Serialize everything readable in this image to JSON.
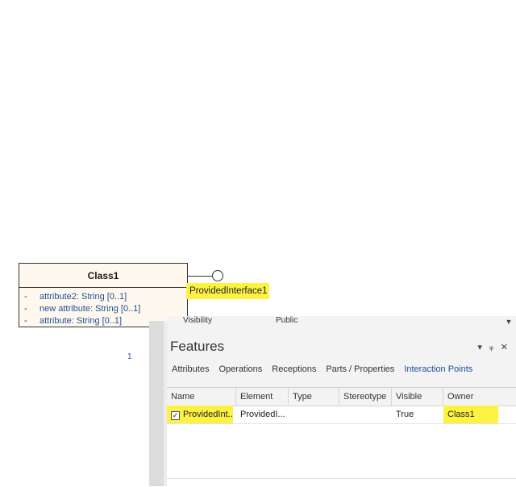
{
  "diagram": {
    "class_name": "Class1",
    "attributes": [
      {
        "visibility": "-",
        "text": "attribute2: String [0..1]"
      },
      {
        "visibility": "-",
        "text": "new attribute: String [0..1]"
      },
      {
        "visibility": "-",
        "text": "attribute: String [0..1]"
      }
    ],
    "port_label": "ProvidedInterface1",
    "stray_mark": "1"
  },
  "property_row": {
    "name": "Visibility",
    "value": "Public",
    "scroll_icon": "▼"
  },
  "features": {
    "title": "Features",
    "controls": {
      "dropdown": "▾",
      "pin": "ᵩ",
      "close": "✕"
    },
    "tabs": [
      "Attributes",
      "Operations",
      "Receptions",
      "Parts / Properties",
      "Interaction Points"
    ],
    "active_tab": "Interaction Points",
    "columns": [
      "Name",
      "Element",
      "Type",
      "Stereotype",
      "Visible",
      "Owner"
    ],
    "rows": [
      {
        "checked": "✓",
        "name": "ProvidedInt...",
        "element": "ProvidedI...",
        "type": "",
        "stereotype": "",
        "visible": "True",
        "owner": "Class1"
      }
    ]
  },
  "colors": {
    "highlight": "#fdf242",
    "link_blue": "#1f4e9c",
    "class_fill": "#fff8ee"
  }
}
